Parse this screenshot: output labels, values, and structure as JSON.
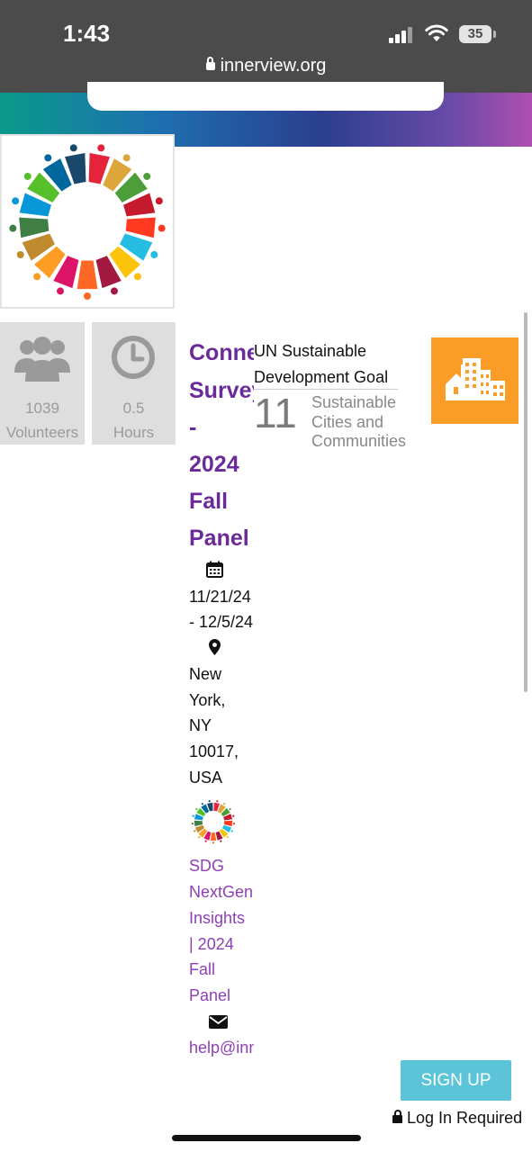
{
  "status_bar": {
    "time": "1:43",
    "battery": "35",
    "url": "innerview.org"
  },
  "stats": {
    "volunteers_count": "1039",
    "volunteers_label": "Volunteers",
    "hours_value": "0.5",
    "hours_label": "Hours"
  },
  "event": {
    "title_lines": [
      "Connec",
      "Survey",
      "-",
      "2024",
      "Fall",
      "Panel"
    ],
    "date_lines": [
      "11/21/24",
      "- 12/5/24"
    ],
    "location_lines": [
      "New",
      "York,",
      "NY",
      "10017,",
      "USA"
    ],
    "org_lines": [
      "SDG",
      "NextGen",
      "Insights",
      "| 2024",
      "Fall",
      "Panel"
    ],
    "email": "help@innerview.org"
  },
  "un_goal": {
    "heading_line1": "UN Sustainable",
    "heading_line2": "Development Goal",
    "number": "11",
    "name_lines": [
      "Sustainable",
      "Cities and",
      "Communities"
    ],
    "tile_color": "#f99d26"
  },
  "actions": {
    "signup_label": "SIGN UP",
    "login_note": "Log In Required"
  },
  "colors": {
    "title_purple": "#6a2a9a",
    "link_purple": "#8f3fb5",
    "signup_blue": "#5bc4d8",
    "status_bar": "#4b4b4b"
  }
}
